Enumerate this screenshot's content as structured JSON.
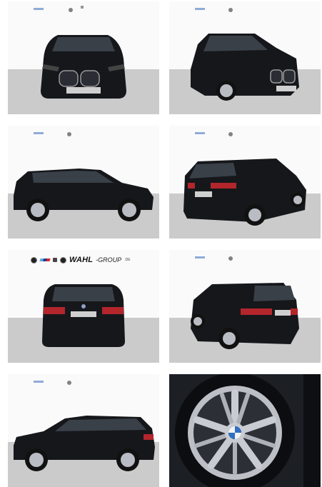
{
  "gallery": {
    "tiles": [
      {
        "view": "front"
      },
      {
        "view": "front-three-quarter-right"
      },
      {
        "view": "side-left"
      },
      {
        "view": "rear-three-quarter-right"
      },
      {
        "view": "rear"
      },
      {
        "view": "rear-three-quarter-left"
      },
      {
        "view": "side-right"
      },
      {
        "view": "wheel-closeup"
      }
    ]
  },
  "banner": {
    "brand": "WAHL",
    "group": "-GROUP",
    "tld": ".DE"
  },
  "colors": {
    "car": "#121418",
    "floor": "#c9c9c9",
    "wall": "#ffffff",
    "rim": "#c8ccd2"
  }
}
